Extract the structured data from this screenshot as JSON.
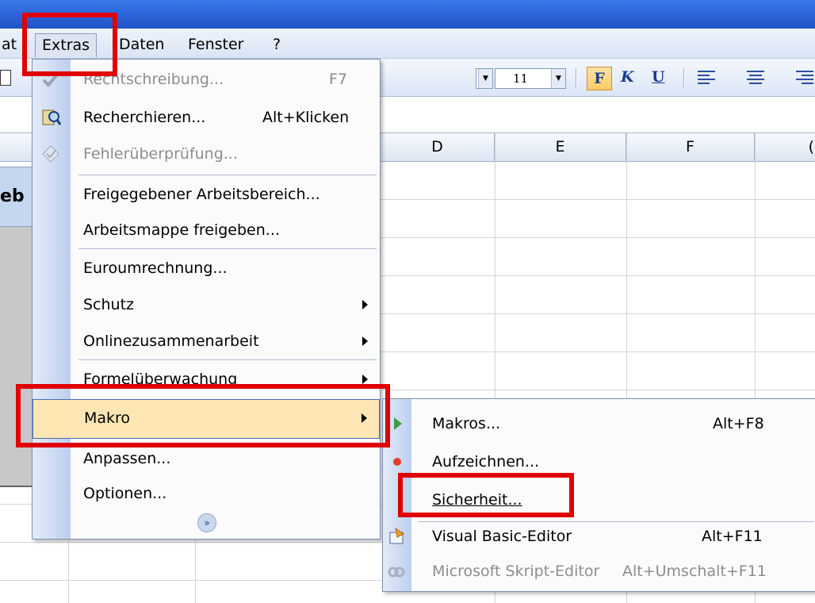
{
  "menubar": {
    "items": [
      "at",
      "Extras",
      "Daten",
      "Fenster",
      "?"
    ]
  },
  "toolbar": {
    "font_size": "11",
    "bold_label": "F",
    "italic_label": "K",
    "underline_label": "U"
  },
  "columns": [
    "D",
    "E",
    "F",
    "("
  ],
  "sheet": {
    "left_text": "eb"
  },
  "extras_menu": {
    "items": [
      {
        "label": "Rechtschreibung...",
        "shortcut": "F7",
        "enabled": false,
        "icon": "spellcheck-icon"
      },
      {
        "label": "Recherchieren...",
        "shortcut": "Alt+Klicken",
        "enabled": true,
        "icon": "research-icon"
      },
      {
        "label": "Fehlerüberprüfung...",
        "shortcut": "",
        "enabled": false,
        "icon": "error-check-icon"
      },
      {
        "label": "Freigegebener Arbeitsbereich...",
        "shortcut": "",
        "enabled": true
      },
      {
        "label": "Arbeitsmappe freigeben...",
        "shortcut": "",
        "enabled": true
      },
      {
        "label": "Euroumrechnung...",
        "shortcut": "",
        "enabled": true
      },
      {
        "label": "Schutz",
        "shortcut": "",
        "enabled": true,
        "submenu": true
      },
      {
        "label": "Onlinezusammenarbeit",
        "shortcut": "",
        "enabled": true,
        "submenu": true
      },
      {
        "label": "Formelüberwachung",
        "shortcut": "",
        "enabled": true,
        "submenu": true
      },
      {
        "label": "Makro",
        "shortcut": "",
        "enabled": true,
        "submenu": true,
        "highlighted": true
      },
      {
        "label": "Anpassen...",
        "shortcut": "",
        "enabled": true
      },
      {
        "label": "Optionen...",
        "shortcut": "",
        "enabled": true
      }
    ],
    "expand_icon": "double-chevron-down-icon"
  },
  "makro_submenu": {
    "items": [
      {
        "label": "Makros...",
        "shortcut": "Alt+F8",
        "enabled": true,
        "icon": "play-icon"
      },
      {
        "label": "Aufzeichnen...",
        "shortcut": "",
        "enabled": true,
        "icon": "record-icon"
      },
      {
        "label": "Sicherheit...",
        "shortcut": "",
        "enabled": true
      },
      {
        "label": "Visual Basic-Editor",
        "shortcut": "Alt+F11",
        "enabled": true,
        "icon": "vb-editor-icon"
      },
      {
        "label": "Microsoft Skript-Editor",
        "shortcut": "Alt+Umschalt+F11",
        "enabled": false,
        "icon": "script-editor-icon"
      }
    ]
  },
  "colors": {
    "title_blue": "#2a63d8",
    "highlight_box": "#e00000",
    "menu_hover": "#fde6b3",
    "menu_strip": "#c7d6f0"
  }
}
